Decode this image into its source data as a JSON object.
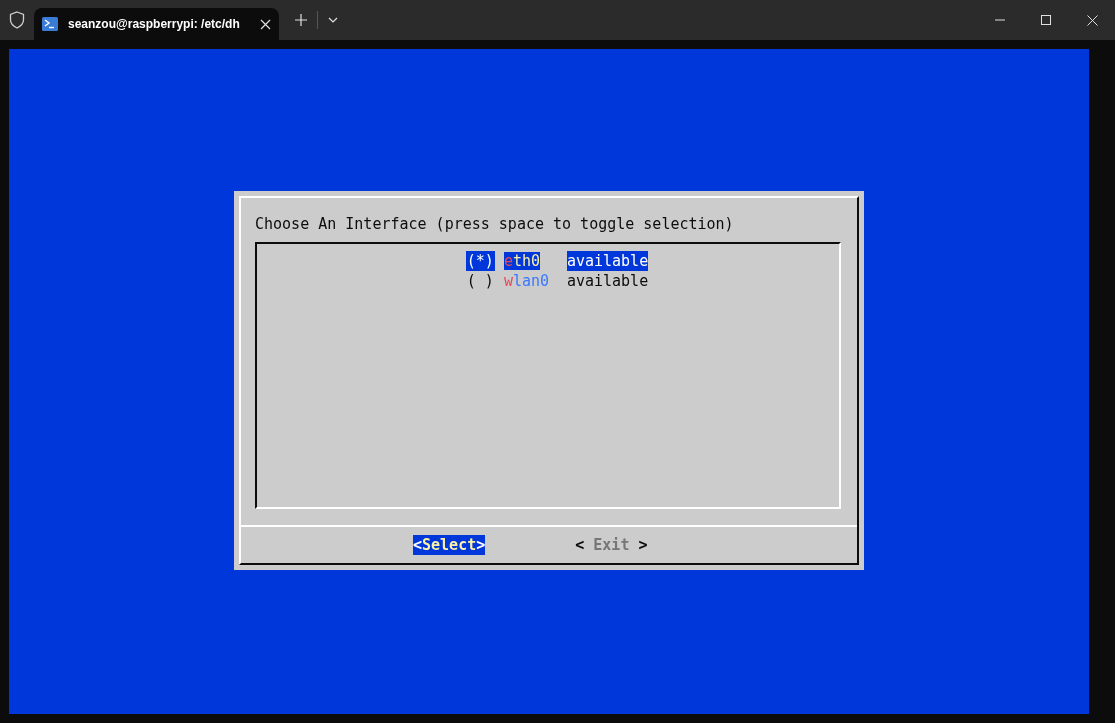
{
  "window": {
    "tab_title": "seanzou@raspberrypi: /etc/dh"
  },
  "dialog": {
    "title": "Choose An Interface (press space to toggle selection)",
    "items": [
      {
        "marker": "(*)",
        "name": "eth0",
        "status": "available",
        "selected": true
      },
      {
        "marker": "( )",
        "name": "wlan0",
        "status": "available",
        "selected": false
      }
    ],
    "buttons": [
      {
        "open": "<",
        "label": "Select",
        "close": ">",
        "selected": true
      },
      {
        "open": "< ",
        "label": "Exit",
        "close": " >",
        "selected": false
      }
    ]
  }
}
